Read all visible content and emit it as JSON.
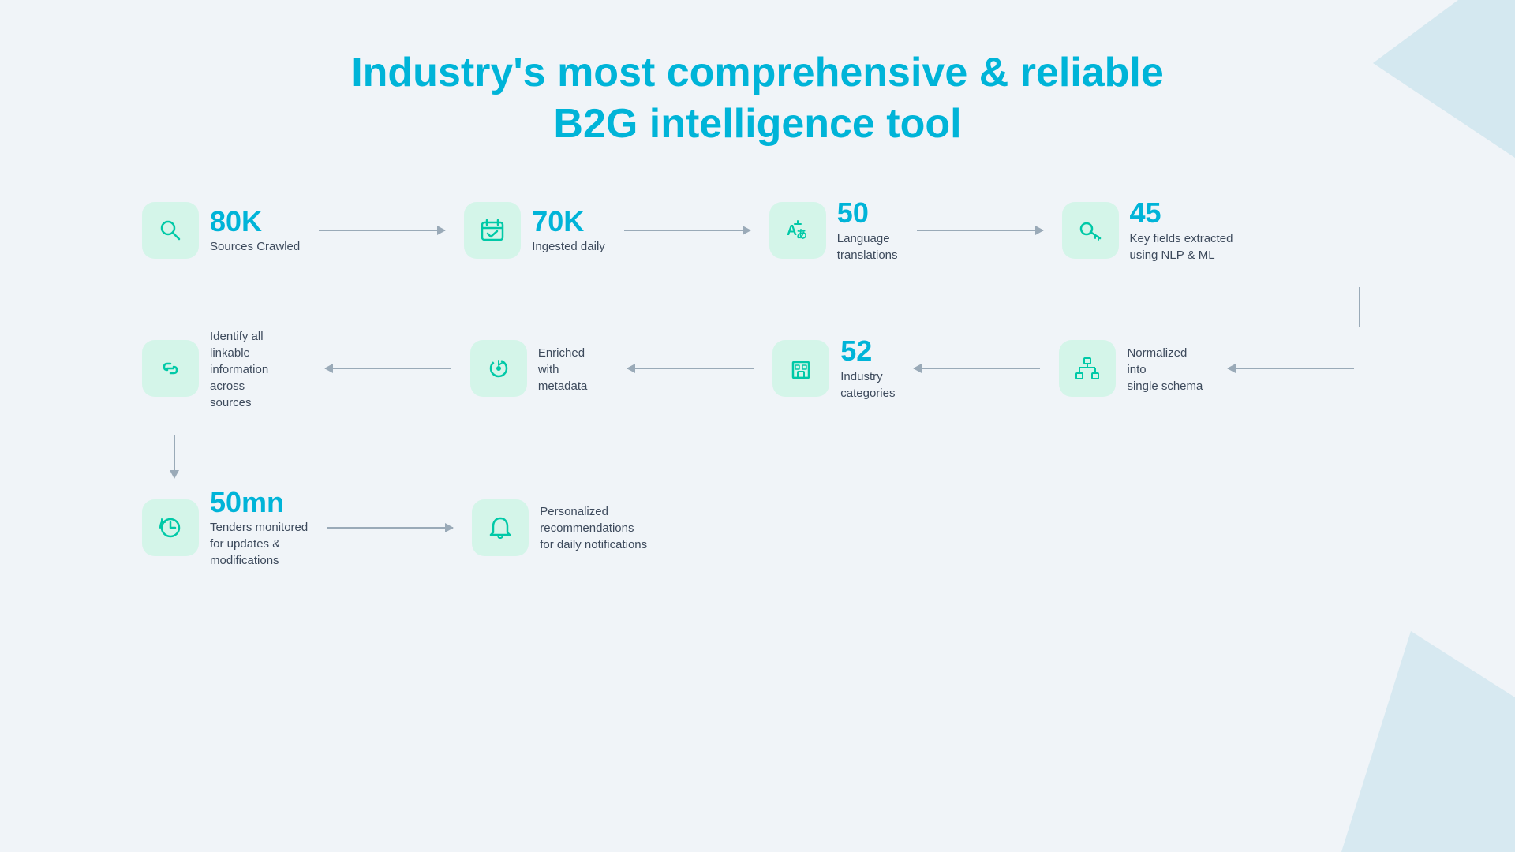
{
  "title": {
    "line1": "Industry's most comprehensive & reliable",
    "line2": "B2G intelligence tool"
  },
  "colors": {
    "teal": "#00b4d8",
    "green_bg": "#d4f5e9",
    "green_icon": "#00c9a7",
    "arrow": "#9aaab8",
    "label": "#3d4a5c"
  },
  "row1": [
    {
      "id": "sources-crawled",
      "number": "80K",
      "label": "Sources Crawled",
      "icon": "search"
    },
    {
      "id": "ingested-daily",
      "number": "70K",
      "label": "Ingested daily",
      "icon": "calendar-check"
    },
    {
      "id": "language-translations",
      "number": "50",
      "label": "Language\ntranslations",
      "icon": "translate"
    },
    {
      "id": "key-fields",
      "number": "45",
      "label": "Key fields extracted\nusing NLP & ML",
      "icon": "key"
    }
  ],
  "row2": [
    {
      "id": "linkable-info",
      "number": null,
      "label": "Identify all linkable\ninformation across\nsources",
      "icon": "link"
    },
    {
      "id": "enriched-metadata",
      "number": null,
      "label": "Enriched with\nmetadata",
      "icon": "refresh-circle"
    },
    {
      "id": "industry-categories",
      "number": "52",
      "label": "Industry\ncategories",
      "icon": "building"
    },
    {
      "id": "normalized-schema",
      "number": null,
      "label": "Normalized into\nsingle schema",
      "icon": "schema"
    }
  ],
  "row3": [
    {
      "id": "tenders-monitored",
      "number": "50mn",
      "label": "Tenders monitored\nfor updates &\nmodifications",
      "icon": "clock-refresh"
    },
    {
      "id": "personalized-recs",
      "number": null,
      "label": "Personalized\nrecommendations\nfor daily notifications",
      "icon": "bell"
    }
  ]
}
